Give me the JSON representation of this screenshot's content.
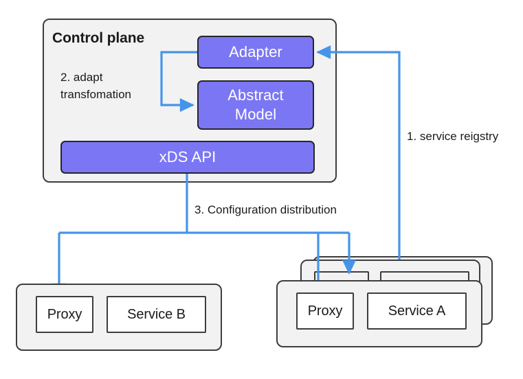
{
  "diagram": {
    "title_visible": false,
    "colors": {
      "accent_purple": "#7b76f4",
      "arrow_blue": "#4594ea",
      "group_fill": "#f2f2f2",
      "box_stroke": "#3d3d3d",
      "text": "#1a1a1a"
    }
  },
  "control_plane": {
    "title": "Control plane",
    "adapter": {
      "label": "Adapter"
    },
    "abstract_model": {
      "line1": "Abstract",
      "line2": "Model"
    },
    "xds_api": {
      "label": "xDS API"
    },
    "step2": {
      "line1": "2. adapt",
      "line2": "transfomation"
    }
  },
  "steps": {
    "step1": "1. service reigstry",
    "step3": "3. Configuration distribution"
  },
  "service_b_group": {
    "proxy": "Proxy",
    "service": "Service B"
  },
  "service_a_group": {
    "proxy": "Proxy",
    "service": "Service A",
    "stack_count": 3
  }
}
